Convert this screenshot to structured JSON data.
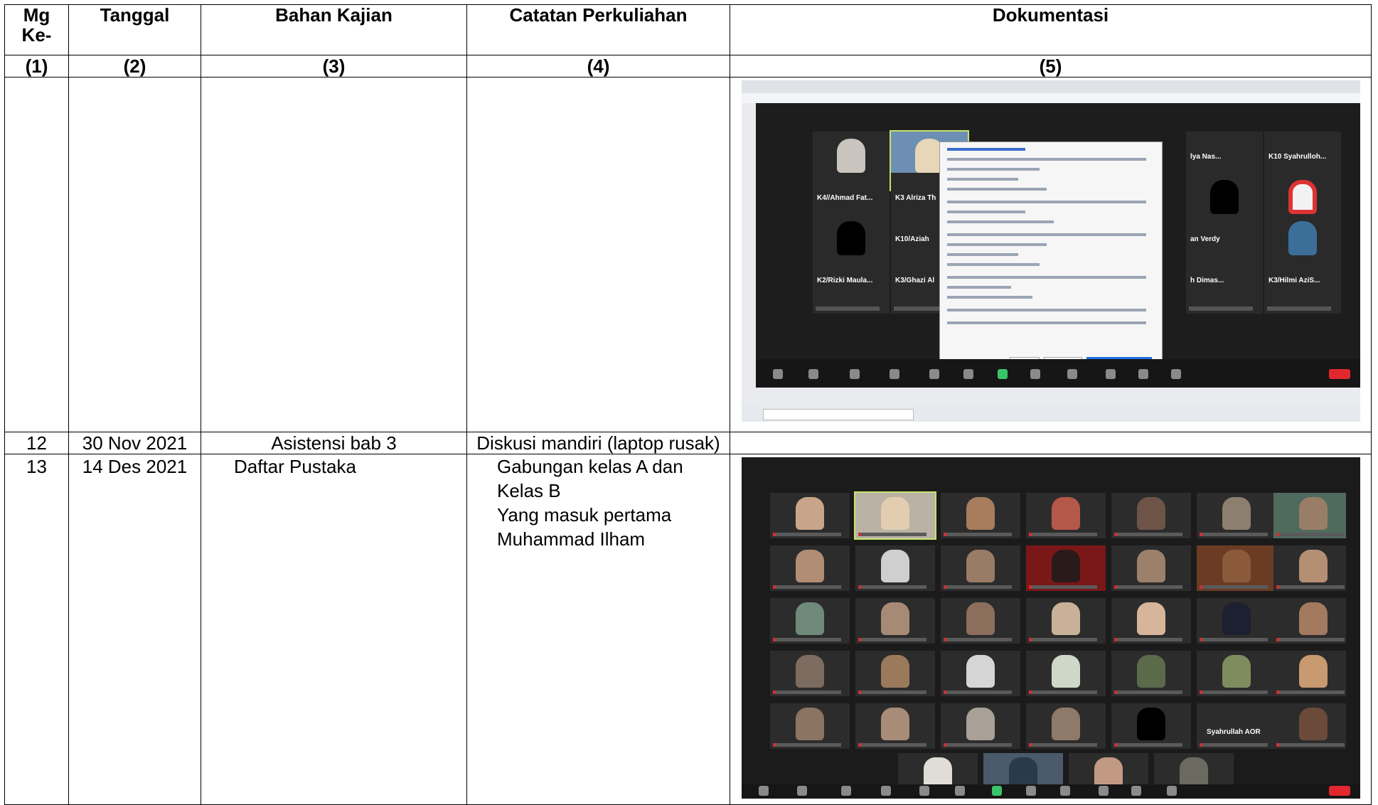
{
  "table": {
    "headers": [
      "Mg Ke-",
      "Tanggal",
      "Bahan Kajian",
      "Catatan Perkuliahan",
      "Dokumentasi"
    ],
    "header_numbers": [
      "(1)",
      "(2)",
      "(3)",
      "(4)",
      "(5)"
    ],
    "rows": [
      {
        "mg": "",
        "tanggal": "",
        "bahan": "",
        "catatan": []
      },
      {
        "mg": "12",
        "tanggal": "30 Nov 2021",
        "bahan": "Asistensi bab 3",
        "catatan": [
          "Diskusi mandiri (laptop rusak)"
        ]
      },
      {
        "mg": "13",
        "tanggal": "14 Des 2021",
        "bahan": "Daftar Pustaka",
        "catatan": [
          "Gabungan kelas A dan",
          "Kelas B",
          "Yang masuk pertama",
          "Muhammad Ilham"
        ]
      }
    ]
  },
  "screenshot1": {
    "tile_names": [
      "K10 Syahrulloh...",
      "K4//Ahmad Fat...",
      "K3 Alriza Th",
      "K10/Aziah",
      "K2/Rizki Maula...",
      "K3/Ghazi Al",
      "K3/Hilmi AziS...",
      "an Verdy",
      "h Dimas...",
      "lya Nas..."
    ]
  },
  "screenshot2": {
    "tile_names": [
      "Syahrullah AOR"
    ]
  }
}
